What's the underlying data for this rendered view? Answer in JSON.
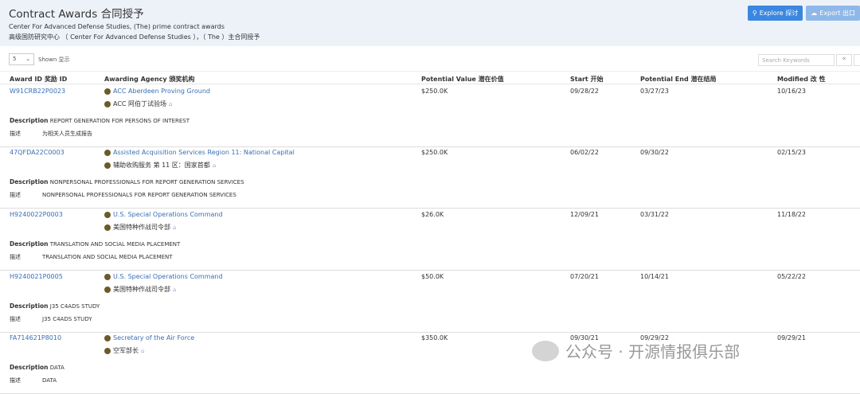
{
  "header": {
    "title": "Contract Awards 合同授予",
    "subtitle_en": "Center For Advanced Defense Studies, (The) prime contract awards",
    "subtitle_zh": "高级国防研究中心 （ Center For Advanced Defense Studies ），（ The ）主合同授予",
    "explore": "Explore 探讨",
    "export": "Export 出口"
  },
  "controls": {
    "page_size": "5",
    "shown": "Shown 显示",
    "search_placeholder": "Search Keywords",
    "prev": "«",
    "next": "»"
  },
  "columns": [
    "Award ID 奖励 ID",
    "Awarding Agency 颁奖机构",
    "Potential Value 潜在价值",
    "Start 开始",
    "Potential End 潜在结局",
    "Modified 改 性"
  ],
  "rows": [
    {
      "id": "W91CRB22P0023",
      "agency": "ACC Aberdeen Proving Ground",
      "agency_zh": "ACC 阿伯丁试验场",
      "value": "$250.0K",
      "start": "09/28/22",
      "end": "03/27/23",
      "modified": "10/16/23",
      "desc_label": "Description",
      "desc": "REPORT GENERATION FOR PERSONS OF INTEREST",
      "desc_label_zh": "描述",
      "desc_zh": "为相关人员生成报告"
    },
    {
      "id": "47QFDA22C0003",
      "agency": "Assisted Acquisition Services Region 11: National Capital",
      "agency_zh": "辅助收购服务 第 11 区：国家首都",
      "value": "$250.0K",
      "start": "06/02/22",
      "end": "09/30/22",
      "modified": "02/15/23",
      "desc_label": "Description",
      "desc": "NONPERSONAL PROFESSIONALS FOR REPORT GENERATION SERVICES",
      "desc_label_zh": "描述",
      "desc_zh": "NONPERSONAL PROFESSIONALS FOR REPORT GENERATION SERVICES"
    },
    {
      "id": "H9240022P0003",
      "agency": "U.S. Special Operations Command",
      "agency_zh": "美国特种作战司令部",
      "value": "$26.0K",
      "start": "12/09/21",
      "end": "03/31/22",
      "modified": "11/18/22",
      "desc_label": "Description",
      "desc": "TRANSLATION AND SOCIAL MEDIA PLACEMENT",
      "desc_label_zh": "描述",
      "desc_zh": "TRANSLATION AND SOCIAL MEDIA PLACEMENT"
    },
    {
      "id": "H9240021P0005",
      "agency": "U.S. Special Operations Command",
      "agency_zh": "美国特种作战司令部",
      "value": "$50.0K",
      "start": "07/20/21",
      "end": "10/14/21",
      "modified": "05/22/22",
      "desc_label": "Description",
      "desc": "J35 C4ADS STUDY",
      "desc_label_zh": "描述",
      "desc_zh": "J35 C4ADS STUDY"
    },
    {
      "id": "FA714621P8010",
      "agency": "Secretary of the Air Force",
      "agency_zh": "空军部长",
      "value": "$350.0K",
      "start": "09/30/21",
      "end": "09/29/22",
      "modified": "09/29/21",
      "desc_label": "Description",
      "desc": "DATA",
      "desc_label_zh": "描述",
      "desc_zh": "DATA"
    }
  ],
  "watermark": "公众号 · 开源情报俱乐部"
}
